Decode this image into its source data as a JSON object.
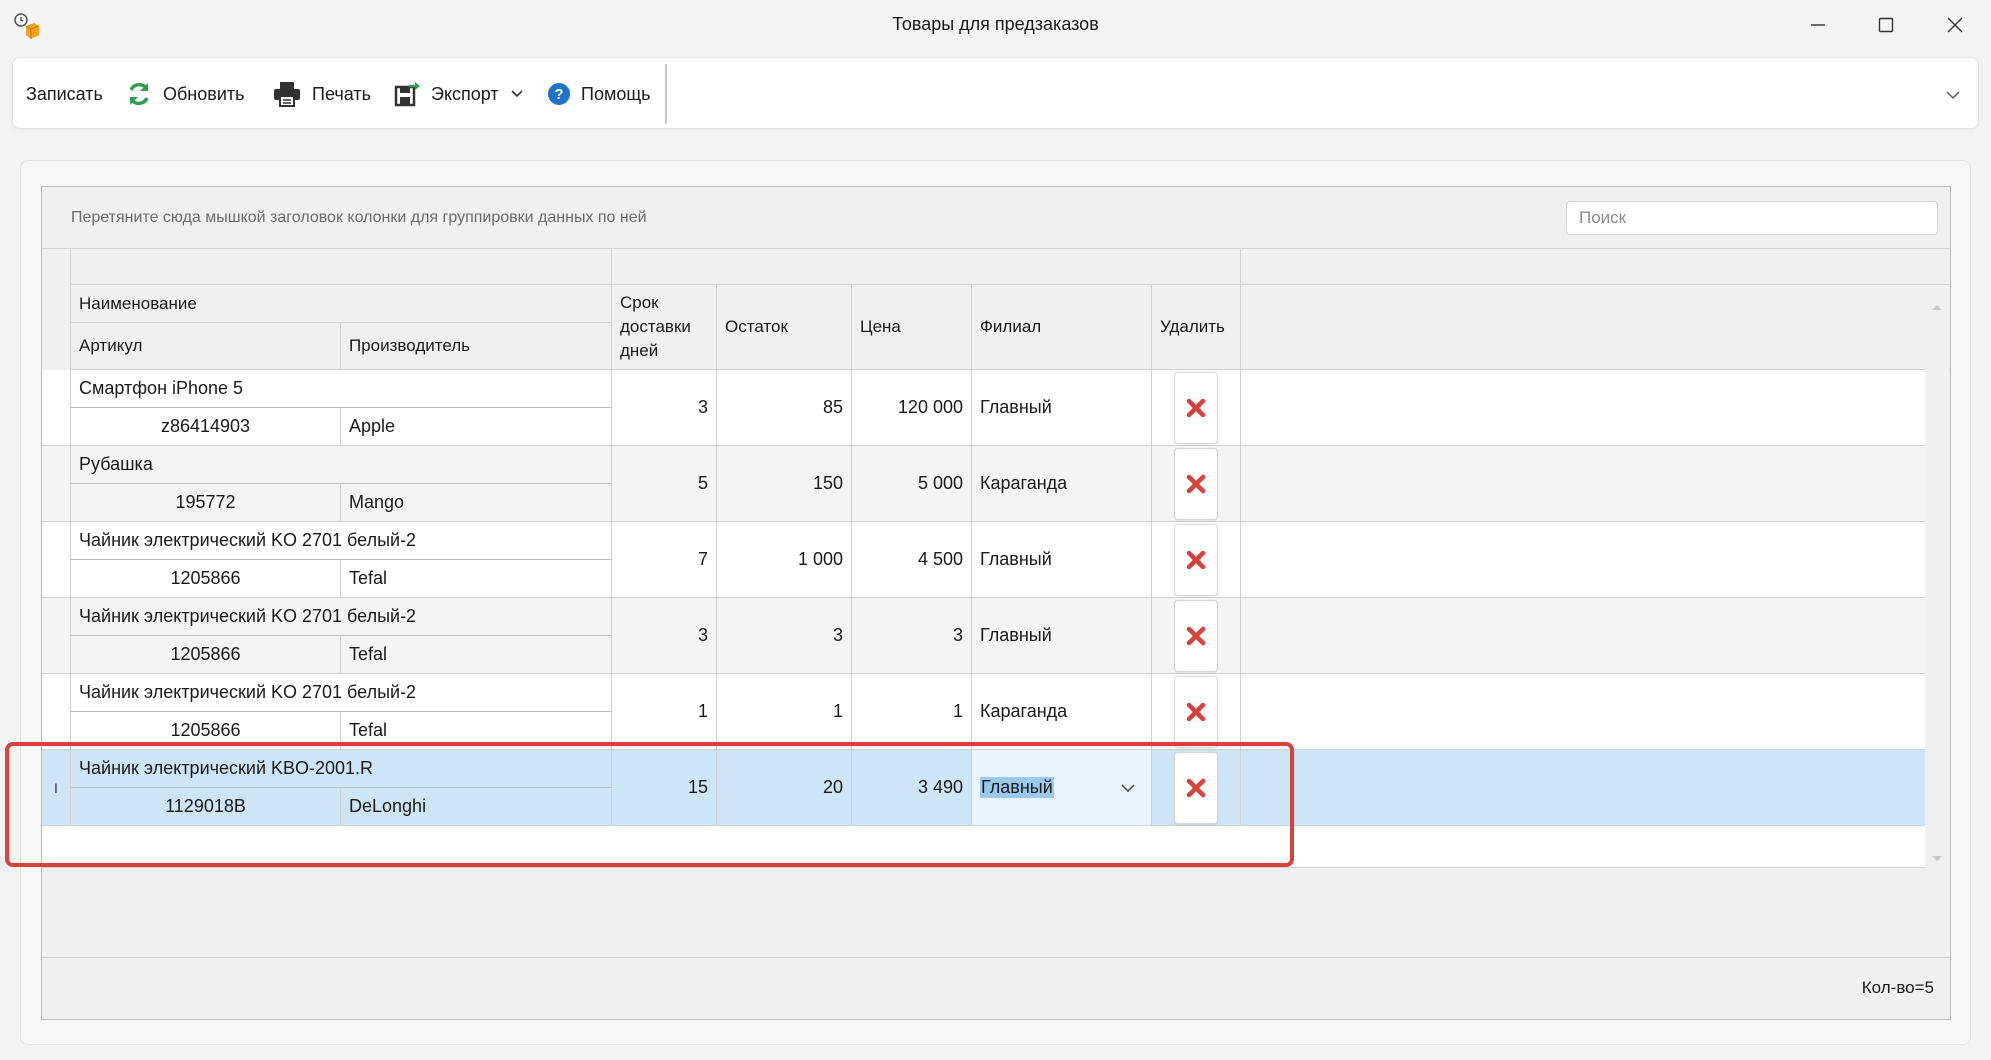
{
  "window": {
    "title": "Товары для предзаказов"
  },
  "toolbar": {
    "save_label": "Записать",
    "refresh_label": "Обновить",
    "print_label": "Печать",
    "export_label": "Экспорт",
    "help_label": "Помощь"
  },
  "grid": {
    "group_hint": "Перетяните сюда мышкой заголовок колонки для группировки данных по ней",
    "search_placeholder": "Поиск",
    "columns": {
      "name": "Наименование",
      "article": "Артикул",
      "manufacturer": "Производитель",
      "delivery": "Срок доставки дней",
      "stock": "Остаток",
      "price": "Цена",
      "branch": "Филиал",
      "delete": "Удалить"
    },
    "rows": [
      {
        "name": "Смартфон iPhone 5",
        "article": "z86414903",
        "manufacturer": "Apple",
        "delivery": "3",
        "stock": "85",
        "price": "120 000",
        "branch": "Главный"
      },
      {
        "name": "Рубашка",
        "article": "195772",
        "manufacturer": "Mango",
        "delivery": "5",
        "stock": "150",
        "price": "5 000",
        "branch": "Караганда"
      },
      {
        "name": "Чайник электрический KO 2701 белый-2",
        "article": "1205866",
        "manufacturer": "Tefal",
        "delivery": "7",
        "stock": "1 000",
        "price": "4 500",
        "branch": "Главный"
      },
      {
        "name": "Чайник электрический KO 2701 белый-2",
        "article": "1205866",
        "manufacturer": "Tefal",
        "delivery": "3",
        "stock": "3",
        "price": "3",
        "branch": "Главный"
      },
      {
        "name": "Чайник электрический KO 2701 белый-2",
        "article": "1205866",
        "manufacturer": "Tefal",
        "delivery": "1",
        "stock": "1",
        "price": "1",
        "branch": "Караганда"
      },
      {
        "name": "Чайник электрический KBO-2001.R",
        "article": "1129018B",
        "manufacturer": "DeLonghi",
        "delivery": "15",
        "stock": "20",
        "price": "3 490",
        "branch": "Главный"
      }
    ],
    "editing_indicator": "I",
    "count_label": "Кол-во=5"
  },
  "colors": {
    "selection": "#cde6f7",
    "highlight_frame": "#d9413b",
    "refresh_icon": "#2e9e4f",
    "help_icon": "#1e73c8",
    "delete_icon": "#d9413b"
  }
}
